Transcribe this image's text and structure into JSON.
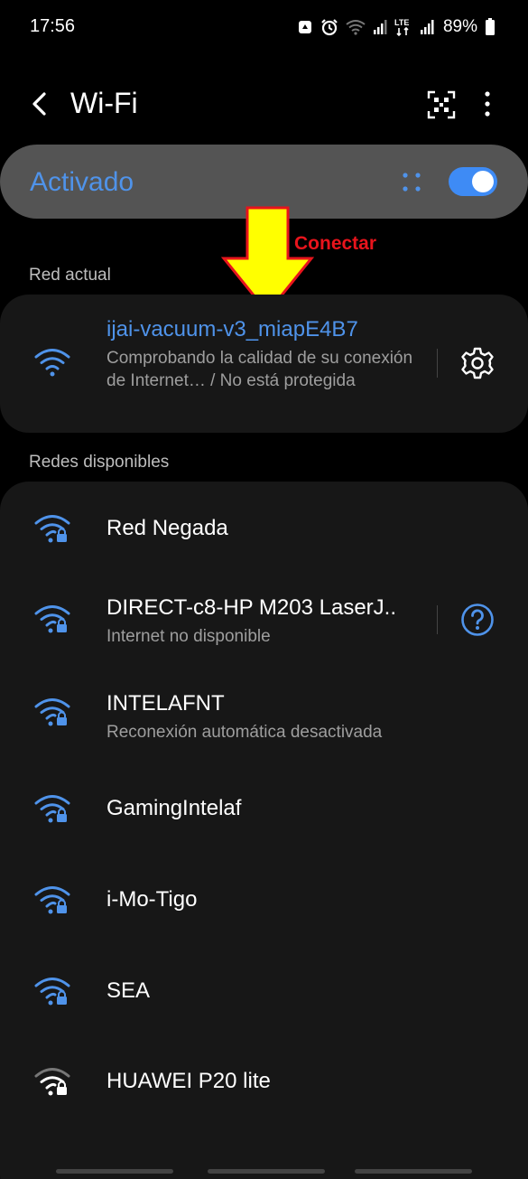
{
  "status_bar": {
    "time": "17:56",
    "battery": "89%",
    "network": "LTE",
    "icons": [
      "recycle-icon",
      "alarm-icon",
      "wifi-status-icon",
      "signal-icon",
      "lte-icon",
      "signal-icon-2",
      "battery-icon"
    ]
  },
  "app_bar": {
    "title": "Wi-Fi",
    "back_icon": "chevron-left-icon",
    "qr_icon": "qr-code-icon",
    "more_icon": "more-vertical-icon"
  },
  "master_switch": {
    "label": "Activado",
    "state": "on"
  },
  "annotation": {
    "text": "Conectar"
  },
  "current_section": {
    "label": "Red actual",
    "network": {
      "name": "ijai-vacuum-v3_miapE4B7",
      "status": "Comprobando la calidad de su conexión de Internet… / No está protegida",
      "icon": "wifi-icon"
    }
  },
  "available_section": {
    "label": "Redes disponibles",
    "networks": [
      {
        "name": "Red Negada",
        "subtitle": "",
        "secured": true
      },
      {
        "name": "DIRECT-c8-HP M203 LaserJ..",
        "subtitle": "Internet no disponible",
        "secured": true
      },
      {
        "name": "INTELAFNT",
        "subtitle": "Reconexión automática desactivada",
        "secured": true
      },
      {
        "name": "GamingIntelaf",
        "subtitle": "",
        "secured": true
      },
      {
        "name": "i-Mo-Tigo",
        "subtitle": "",
        "secured": true
      },
      {
        "name": "SEA",
        "subtitle": "",
        "secured": true
      },
      {
        "name": "HUAWEI P20 lite",
        "subtitle": "",
        "secured": true
      }
    ]
  },
  "colors": {
    "accent": "#4f93ea",
    "background": "#000000",
    "card": "#171717",
    "master_card": "#545454",
    "annotation_arrow": "#ffff00",
    "annotation_text": "#e8141c"
  }
}
